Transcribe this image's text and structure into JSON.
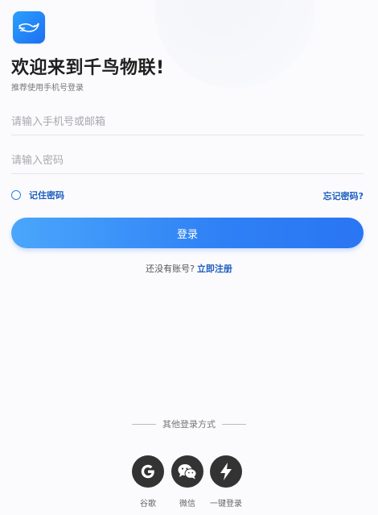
{
  "header": {
    "app_logo": "bird-logo-icon",
    "title": "欢迎来到千鸟物联!",
    "subtitle": "推荐使用手机号登录"
  },
  "form": {
    "phone_placeholder": "请输入手机号或邮箱",
    "password_placeholder": "请输入密码",
    "remember_label": "记住密码",
    "forgot_label": "忘记密码?",
    "login_label": "登录"
  },
  "register": {
    "prompt": "还没有账号?",
    "link": "立即注册"
  },
  "other_login": {
    "label": "其他登录方式",
    "options": [
      {
        "label": "谷歌",
        "icon": "google-icon"
      },
      {
        "label": "微信",
        "icon": "wechat-icon"
      },
      {
        "label": "一键登录",
        "icon": "lightning-icon"
      }
    ]
  },
  "colors": {
    "accent": "#2f80f5",
    "link": "#1f5fbf",
    "social_bg": "#333333"
  }
}
